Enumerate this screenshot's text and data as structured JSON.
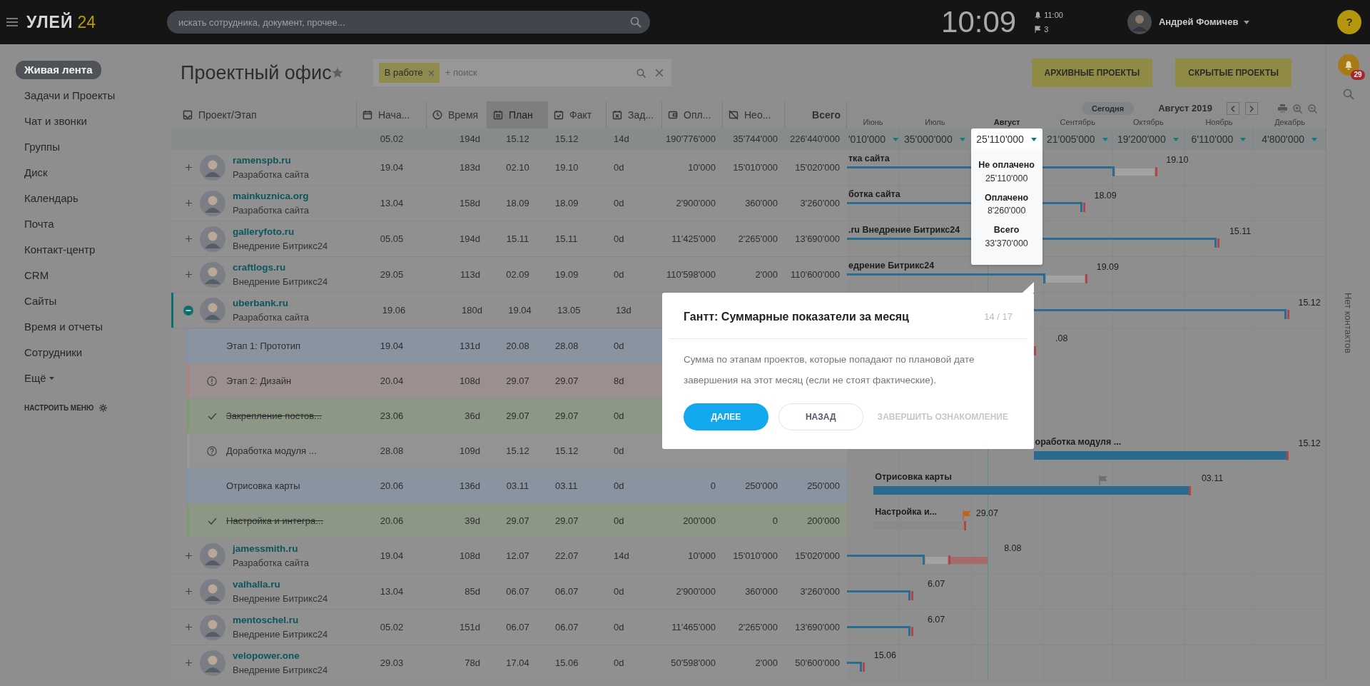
{
  "topbar": {
    "logo": "УЛЕЙ",
    "logo_number": "24",
    "search": {
      "placeholder": "искать сотрудника, документ, прочее..."
    },
    "clock": "10:09",
    "reminder": "11:00",
    "flags": "3",
    "user": "Андрей Фомичев",
    "help": "?"
  },
  "sidebar": {
    "items": [
      {
        "label": "Живая лента",
        "selected": true,
        "kind": "link"
      },
      {
        "label": "Задачи и Проекты",
        "selected": false,
        "kind": "link"
      },
      {
        "label": "Чат и звонки",
        "selected": false,
        "kind": "link"
      },
      {
        "label": "Группы",
        "selected": false,
        "kind": "link"
      },
      {
        "label": "Диск",
        "selected": false,
        "kind": "link"
      },
      {
        "label": "Календарь",
        "selected": false,
        "kind": "link"
      },
      {
        "label": "Почта",
        "selected": false,
        "kind": "link"
      },
      {
        "label": "Контакт-центр",
        "selected": false,
        "kind": "link"
      },
      {
        "label": "CRM",
        "selected": false,
        "kind": "link"
      },
      {
        "label": "Сайты",
        "selected": false,
        "kind": "link"
      },
      {
        "label": "Время и отчеты",
        "selected": false,
        "kind": "link"
      },
      {
        "label": "Сотрудники",
        "selected": false,
        "kind": "link"
      },
      {
        "label": "Ещё",
        "selected": false,
        "kind": "more"
      }
    ],
    "configure": "НАСТРОИТЬ МЕНЮ"
  },
  "page": {
    "title": "Проектный офис",
    "filter": {
      "tag": "В работе",
      "placeholder": "+ поиск"
    },
    "buttons": [
      "АРХИВНЫЕ ПРОЕКТЫ",
      "СКРЫТЫЕ ПРОЕКТЫ"
    ]
  },
  "table": {
    "project_column": {
      "label": "Проект/Этап",
      "selected": false
    },
    "columns": [
      {
        "label": "Нача...",
        "selected": false
      },
      {
        "label": "Время",
        "selected": false
      },
      {
        "label": "План",
        "selected": true
      },
      {
        "label": "Факт",
        "selected": false
      },
      {
        "label": "Зад...",
        "selected": false
      },
      {
        "label": "Опл...",
        "selected": false
      },
      {
        "label": "Нео...",
        "selected": false
      },
      {
        "label": "Всего",
        "selected": false
      }
    ],
    "summary": [
      "05.02",
      "194d",
      "15.12",
      "15.12",
      "14d",
      "190'776'000",
      "35'744'000",
      "226'440'000"
    ],
    "rows": [
      {
        "name": "ramenspb.ru",
        "subtitle": "Разработка сайта",
        "expanded": false,
        "cells": [
          "19.04",
          "183d",
          "02.10",
          "19.10",
          "0d",
          "10'000",
          "15'010'000",
          "15'020'000"
        ],
        "gantt": {
          "label": "тка сайта",
          "date": "19.10"
        }
      },
      {
        "name": "mainkuznica.org",
        "subtitle": "Разработка сайта",
        "expanded": false,
        "cells": [
          "13.04",
          "158d",
          "18.09",
          "18.09",
          "0d",
          "2'900'000",
          "360'000",
          "3'260'000"
        ],
        "gantt": {
          "label": "ботка сайта",
          "date": "18.09"
        }
      },
      {
        "name": "galleryfoto.ru",
        "subtitle": "Внедрение Битрикс24",
        "expanded": false,
        "cells": [
          "05.05",
          "194d",
          "15.11",
          "15.11",
          "0d",
          "11'425'000",
          "2'265'000",
          "13'690'000"
        ],
        "gantt": {
          "label": ".ru Внедрение Битрикс24",
          "date": "15.11"
        }
      },
      {
        "name": "craftlogs.ru",
        "subtitle": "Внедрение Битрикс24",
        "expanded": false,
        "cells": [
          "29.05",
          "113d",
          "02.09",
          "19.09",
          "0d",
          "110'598'000",
          "2'000",
          "110'600'000"
        ],
        "gantt": {
          "label": "едрение Битрикс24",
          "date": "19.09"
        }
      },
      {
        "name": "uberbank.ru",
        "subtitle": "Разработка сайта",
        "expanded": true,
        "cells": [
          "19.06",
          "180d",
          "19.04",
          "13.05",
          "13d"
        ],
        "gantt": {
          "date": "15.12"
        },
        "children": [
          {
            "name": "Этап 1: Прототип",
            "kind": "open",
            "cells": [
              "19.04",
              "131d",
              "20.08",
              "28.08",
              "0d"
            ],
            "gantt": {
              "date": ".08"
            }
          },
          {
            "name": "Этап 2: Дизайн",
            "kind": "overdue",
            "cells": [
              "20.04",
              "108d",
              "29.07",
              "29.07",
              "8d"
            ]
          },
          {
            "name": "Закрепление постов...",
            "kind": "done",
            "cells": [
              "23.06",
              "36d",
              "29.07",
              "29.07",
              "0d"
            ]
          },
          {
            "name": "Доработка модуля ...",
            "kind": "unknown",
            "cells": [
              "28.08",
              "109d",
              "15.12",
              "15.12",
              "0d"
            ],
            "gantt": {
              "label": "оработка модуля ...",
              "date": "15.12"
            }
          },
          {
            "name": "Отрисовка карты",
            "kind": "open",
            "cells": [
              "20.06",
              "136d",
              "03.11",
              "03.11",
              "0d",
              "0",
              "250'000",
              "250'000"
            ],
            "gantt": {
              "label": "Отрисовка карты",
              "date": "03.11",
              "flag": {
                "color": "#6f6f6f",
                "level": 0.72
              }
            }
          },
          {
            "name": "Настройка и интегра...",
            "kind": "done",
            "cells": [
              "20.06",
              "39d",
              "29.07",
              "29.07",
              "0d",
              "200'000",
              "0",
              "200'000"
            ],
            "gantt": {
              "label": "Настройка и...",
              "date": "29.07",
              "flag": {
                "color": "#c0621e",
                "level": 1
              }
            }
          }
        ]
      },
      {
        "name": "jamessmith.ru",
        "subtitle": "Разработка сайта",
        "expanded": false,
        "cells": [
          "19.04",
          "108d",
          "12.07",
          "22.07",
          "14d",
          "10'000",
          "15'010'000",
          "15'020'000"
        ],
        "gantt": {
          "date": "8.08"
        }
      },
      {
        "name": "valhalla.ru",
        "subtitle": "Внедрение Битрикс24",
        "expanded": false,
        "cells": [
          "13.04",
          "85d",
          "06.07",
          "06.07",
          "0d",
          "2'900'000",
          "360'000",
          "3'260'000"
        ],
        "gantt": {
          "date": "6.07"
        }
      },
      {
        "name": "mentoschel.ru",
        "subtitle": "Внедрение Битрикс24",
        "expanded": false,
        "cells": [
          "05.02",
          "151d",
          "06.07",
          "06.07",
          "0d",
          "11'465'000",
          "2'265'000",
          "13'690'000"
        ],
        "gantt": {
          "date": "6.07"
        }
      },
      {
        "name": "velopower.one",
        "subtitle": "Внедрение Битрикс24",
        "expanded": false,
        "cells": [
          "29.03",
          "78d",
          "17.04",
          "15.06",
          "0d",
          "50'598'000",
          "2'000",
          "50'600'000"
        ],
        "gantt": {
          "date": "15.06"
        }
      }
    ]
  },
  "gantt": {
    "today": "Сегодня",
    "period": "Август 2019",
    "months": [
      {
        "name": "Июнь",
        "sum": "'010'000",
        "selected": false
      },
      {
        "name": "Июль",
        "sum": "35'000'000",
        "selected": false
      },
      {
        "name": "Август",
        "sum": "25'110'000",
        "selected": true,
        "details": [
          {
            "label": "Не оплачено",
            "value": "25'110'000"
          },
          {
            "label": "Оплачено",
            "value": "8'260'000"
          },
          {
            "label": "Всего",
            "value": "33'370'000"
          }
        ]
      },
      {
        "name": "Сентябрь",
        "sum": "21'005'000",
        "selected": false
      },
      {
        "name": "Октябрь",
        "sum": "19'200'000",
        "selected": false
      },
      {
        "name": "Ноябрь",
        "sum": "6'110'000",
        "selected": false
      },
      {
        "name": "Декабрь",
        "sum": "4'800'000",
        "selected": false
      }
    ]
  },
  "tour": {
    "title": "Гантт: Суммарные показатели за месяц",
    "counter": "14 / 17",
    "text": "Сумма по этапам проектов, которые попадают по плановой дате завершения на этот месяц (если не стоят фактические).",
    "buttons": [
      {
        "label": "ДАЛЕЕ",
        "kind": "primary"
      },
      {
        "label": "НАЗАД",
        "kind": "secondary"
      },
      {
        "label": "ЗАВЕРШИТЬ ОЗНАКОМЛЕНИЕ",
        "kind": "link"
      }
    ]
  },
  "right_panel": {
    "badge": "29",
    "contacts": "Нет контактов"
  }
}
